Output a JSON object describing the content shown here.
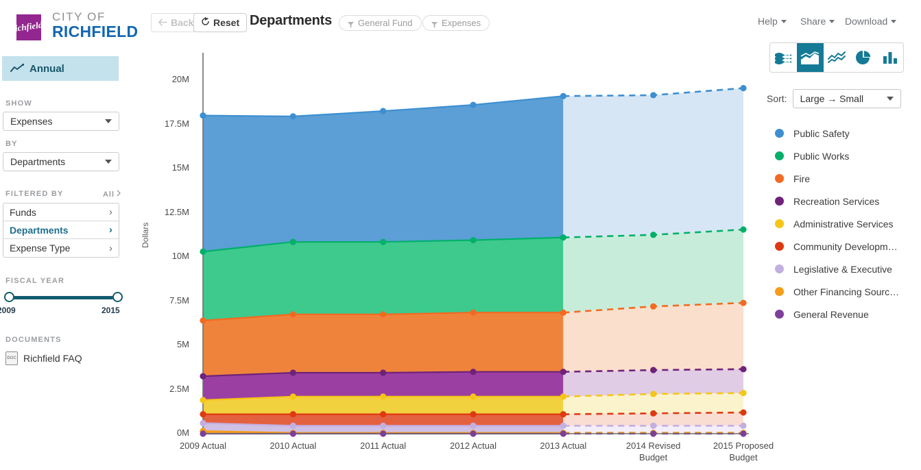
{
  "brand": {
    "line1": "CITY OF",
    "line2": "RICHFIELD",
    "mark_text": "Richfield"
  },
  "sidebar": {
    "annual_tab": {
      "label": "Annual",
      "icon": "line-chart-icon"
    },
    "show": {
      "label": "SHOW",
      "value": "Expenses"
    },
    "by": {
      "label": "BY",
      "value": "Departments"
    },
    "filtered_by": {
      "label": "FILTERED BY",
      "all_label": "All"
    },
    "filters": [
      {
        "label": "Funds",
        "active": false
      },
      {
        "label": "Departments",
        "active": true
      },
      {
        "label": "Expense Type",
        "active": false
      }
    ],
    "fiscal_year": {
      "label": "FISCAL YEAR",
      "min": "2009",
      "max": "2015"
    },
    "documents": {
      "label": "DOCUMENTS",
      "items": [
        {
          "label": "Richfield FAQ",
          "icon": "document-icon"
        }
      ]
    }
  },
  "toolbar": {
    "back_label": "Back",
    "reset_label": "Reset",
    "title": "Departments",
    "pills": [
      "General Fund",
      "Expenses"
    ],
    "menus": [
      "Help",
      "Share",
      "Download"
    ]
  },
  "chart_controls": {
    "types": [
      {
        "name": "stream-chart-icon",
        "selected": false
      },
      {
        "name": "stacked-area-chart-icon",
        "selected": true
      },
      {
        "name": "line-chart-icon",
        "selected": false
      },
      {
        "name": "pie-chart-icon",
        "selected": false
      },
      {
        "name": "bar-chart-icon",
        "selected": false
      }
    ],
    "sort_label": "Sort:",
    "sort_value": "Large → Small"
  },
  "chart_data": {
    "type": "area",
    "title": "Departments",
    "xlabel": "",
    "ylabel": "Dollars",
    "ylim": [
      0,
      21500000
    ],
    "yticks": [
      "0M",
      "2.5M",
      "5M",
      "7.5M",
      "10M",
      "12.5M",
      "15M",
      "17.5M",
      "20M"
    ],
    "ytick_values": [
      0,
      2500000,
      5000000,
      7500000,
      10000000,
      12500000,
      15000000,
      17500000,
      20000000
    ],
    "grid": false,
    "stacked": true,
    "legend_position": "right",
    "categories": [
      "2009 Actual",
      "2010 Actual",
      "2011 Actual",
      "2012 Actual",
      "2013 Actual",
      "2014 Revised\nBudget",
      "2015 Proposed\nBudget"
    ],
    "projection_start_index": 4,
    "projection_note": "Values from 2014 onward are drawn with dashed lines and lighter fills (budgeted, not actual).",
    "series": [
      {
        "name": "Public Safety",
        "color": "#3d8fd1",
        "fill": "#5b9fd6",
        "fill_projected": "#d7e6f4",
        "values": [
          7700000,
          7100000,
          7400000,
          7650000,
          8000000,
          7900000,
          8000000
        ]
      },
      {
        "name": "Public Works",
        "color": "#00b06a",
        "fill": "#3ec98d",
        "fill_projected": "#c7edda",
        "values": [
          3900000,
          4100000,
          4100000,
          4100000,
          4250000,
          4050000,
          4150000
        ]
      },
      {
        "name": "Fire",
        "color": "#f26a21",
        "fill": "#f0833c",
        "fill_projected": "#fadfcc",
        "values": [
          3150000,
          3300000,
          3300000,
          3350000,
          3350000,
          3600000,
          3750000
        ]
      },
      {
        "name": "Recreation Services",
        "color": "#6f2279",
        "fill": "#9b3fa3",
        "fill_projected": "#e0cce4",
        "values": [
          1350000,
          1350000,
          1350000,
          1400000,
          1400000,
          1350000,
          1350000
        ]
      },
      {
        "name": "Administrative Services",
        "color": "#f5c518",
        "fill": "#f2d13f",
        "fill_projected": "#fbf3cc",
        "values": [
          800000,
          1000000,
          1000000,
          1000000,
          1000000,
          1100000,
          1100000
        ]
      },
      {
        "name": "Community Development",
        "color": "#de3a11",
        "fill": "#e4613f",
        "fill_projected": "#f9ddd3",
        "values": [
          500000,
          650000,
          650000,
          650000,
          650000,
          700000,
          750000
        ]
      },
      {
        "name": "Legislative & Executive",
        "color": "#c3aee0",
        "fill": "#cfc0e6",
        "fill_projected": "#f3eef9",
        "values": [
          450000,
          400000,
          400000,
          400000,
          400000,
          400000,
          400000
        ]
      },
      {
        "name": "Other Financing Sources",
        "color": "#f59c18",
        "fill": "#f5a623",
        "fill_projected": "#fcebd1",
        "values": [
          150000,
          50000,
          50000,
          50000,
          50000,
          50000,
          50000
        ]
      },
      {
        "name": "General Revenue",
        "color": "#7d3f98",
        "fill": "#8b4aa3",
        "fill_projected": "#e3d6ea",
        "values": [
          0,
          0,
          0,
          0,
          0,
          0,
          0
        ]
      }
    ],
    "legend_entries": [
      {
        "label": "Public Safety",
        "color": "#3d8fd1"
      },
      {
        "label": "Public Works",
        "color": "#00b06a"
      },
      {
        "label": "Fire",
        "color": "#f26a21"
      },
      {
        "label": "Recreation Services",
        "color": "#6f2279"
      },
      {
        "label": "Administrative Services",
        "color": "#f5c518"
      },
      {
        "label": "Community Developm…",
        "color": "#de3a11"
      },
      {
        "label": "Legislative & Executive",
        "color": "#c3aee0"
      },
      {
        "label": "Other Financing Sourc…",
        "color": "#f59c18"
      },
      {
        "label": "General Revenue",
        "color": "#7d3f98"
      }
    ]
  }
}
